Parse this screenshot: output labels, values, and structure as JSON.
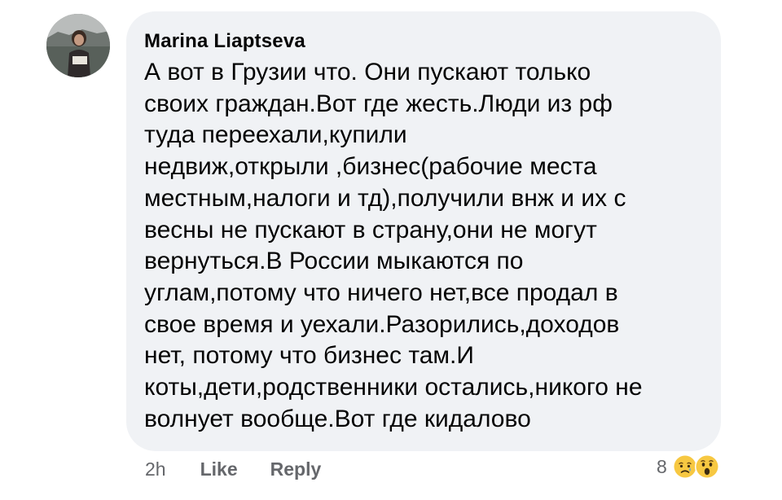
{
  "comment": {
    "author": "Marina Liaptseva",
    "lines": [
      "А вот в Грузии что. Они пускают только",
      "своих граждан.Вот где жесть.Люди из рф",
      "туда переехали,купили",
      "недвиж,открыли ,бизнес(рабочие места",
      "местным,налоги и тд),получили внж и их с",
      "весны не пускают в страну,они не могут",
      "вернуться.В России мыкаются по",
      "углам,потому что ничего нет,все продал в",
      "свое время и уехали.Разорились,доходов",
      "нет, потому что бизнес там.И",
      "коты,дети,родственники остались,никого не",
      "волнует вообще.Вот где кидалово"
    ]
  },
  "actions": {
    "time": "2h",
    "like_label": "Like",
    "reply_label": "Reply"
  },
  "reactions": {
    "count": "8",
    "icons": [
      "sad-reaction-icon",
      "wow-reaction-icon"
    ]
  },
  "colors": {
    "bubble": "#f0f2f5",
    "text": "#050505",
    "meta": "#65676b",
    "reaction_yellow": "#f7c842"
  }
}
